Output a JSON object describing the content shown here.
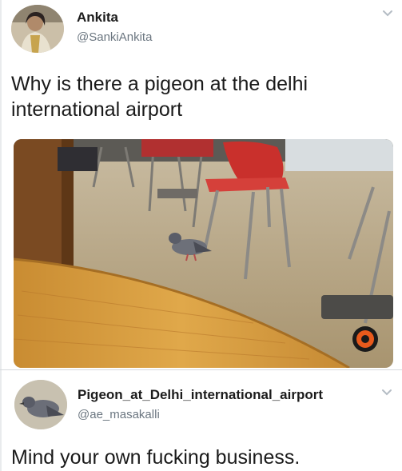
{
  "tweets": [
    {
      "author": {
        "name": "Ankita",
        "handle": "@SankiAnkita",
        "avatar_icon": "woman-portrait-avatar"
      },
      "text_line_1": "Why is there a pigeon at the delhi",
      "text_line_2": "international airport",
      "media": {
        "icon": "pigeon-airport-photo",
        "watermark_icon": "circular-logo-watermark"
      },
      "menu_icon": "chevron-down-icon"
    },
    {
      "author": {
        "name": "Pigeon_at_Delhi_international_airport",
        "handle": "@ae_masakalli",
        "avatar_icon": "pigeon-avatar"
      },
      "text_line_1": "Mind your own fucking business.",
      "menu_icon": "chevron-down-icon"
    }
  ],
  "colors": {
    "name_text": "#1c1c1c",
    "handle_text": "#6b7680",
    "divider": "#d5d9dc",
    "chevron": "#b4bcc4"
  }
}
